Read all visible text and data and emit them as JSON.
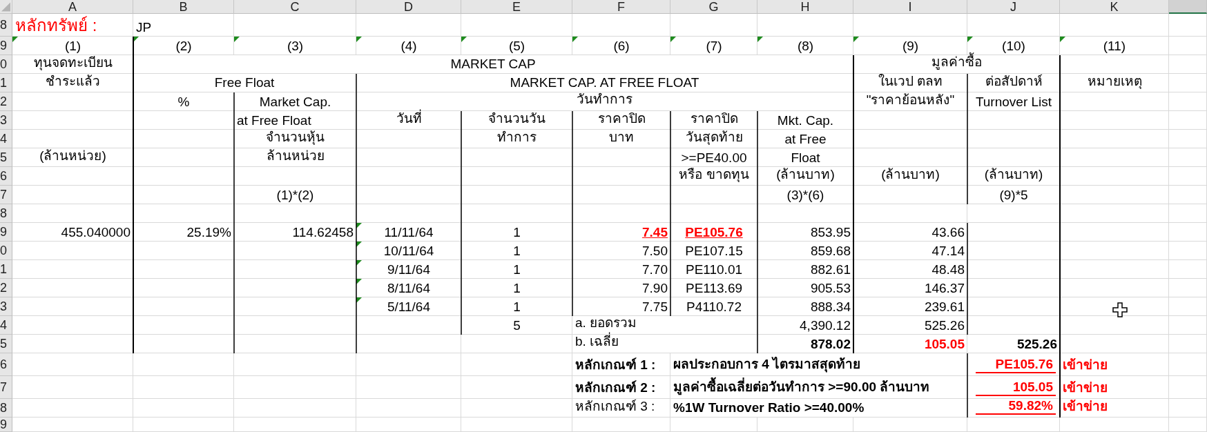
{
  "column_headers": [
    {
      "label": "A",
      "selected": false
    },
    {
      "label": "B",
      "selected": false
    },
    {
      "label": "C",
      "selected": false
    },
    {
      "label": "D",
      "selected": false
    },
    {
      "label": "E",
      "selected": false
    },
    {
      "label": "F",
      "selected": false
    },
    {
      "label": "G",
      "selected": false
    },
    {
      "label": "H",
      "selected": false
    },
    {
      "label": "I",
      "selected": false
    },
    {
      "label": "J",
      "selected": false
    },
    {
      "label": "K",
      "selected": false
    },
    {
      "selected": true
    }
  ],
  "row_numbers": [
    "8",
    "9",
    "0",
    "1",
    "2",
    "3",
    "4",
    "5",
    "6",
    "7",
    "8",
    "9",
    "0",
    "1",
    "2",
    "3",
    "4",
    "5",
    "6",
    "7",
    "8",
    "9"
  ],
  "security": {
    "label": "หลักทรัพย์ :",
    "value": "JP"
  },
  "column_numbers": [
    {
      "text": "(1)",
      "flagged": true
    },
    {
      "text": "(2)",
      "flagged": true
    },
    {
      "text": "(3)",
      "flagged": true
    },
    {
      "text": "(4)",
      "flagged": true
    },
    {
      "text": "(5)",
      "flagged": true
    },
    {
      "text": "(6)",
      "flagged": true
    },
    {
      "text": "(7)",
      "flagged": true
    },
    {
      "text": "(8)",
      "flagged": true
    },
    {
      "text": "(9)",
      "flagged": true
    },
    {
      "text": "(10)",
      "flagged": true
    },
    {
      "text": "(11)",
      "flagged": true
    }
  ],
  "header_rows": [
    [
      "ทุนจดทะเบียน",
      "MARKET CAP",
      "มูลค่าซื้อ"
    ],
    [
      "ชำระแล้ว",
      "Free Float",
      "MARKET CAP. AT FREE FLOAT",
      "ในเวป ตลท",
      "ต่อสัปดาห์",
      "หมายเหตุ"
    ],
    [
      "%",
      "Market Cap.",
      "วันทำการ",
      "\"ราคาย้อนหลัง\"",
      "Turnover List"
    ],
    [
      "at Free Float",
      "วันที่",
      "จำนวนวัน",
      "ราคาปิด",
      "ราคาปิด",
      "Mkt. Cap."
    ],
    [
      "จำนวนหุ้น",
      "ทำการ",
      "บาท",
      "วันสุดท้าย",
      "at Free"
    ],
    [
      "(ล้านหน่วย)",
      "ล้านหน่วย",
      ">=PE40.00",
      "Float"
    ],
    [
      "หรือ ขาดทุน",
      "(ล้านบาท)",
      "(ล้านบาท)",
      "(ล้านบาท)"
    ],
    [
      "(1)*(2)",
      "(3)*(6)",
      "(9)*5"
    ]
  ],
  "summary": {
    "registered_capital": "455.040000",
    "free_float_pct": "25.19%",
    "market_cap_free_float": "114.62458"
  },
  "days": [
    {
      "date": "11/11/64",
      "date_flagged": true,
      "count": "1",
      "close": "7.45",
      "close_alert": true,
      "pe": "PE105.76",
      "pe_alert": true,
      "mkt_cap": "853.95",
      "turnover": "43.66"
    },
    {
      "date": "10/11/64",
      "date_flagged": true,
      "count": "1",
      "close": "7.50",
      "close_alert": false,
      "pe": "PE107.15",
      "pe_alert": false,
      "mkt_cap": "859.68",
      "turnover": "47.14"
    },
    {
      "date": "9/11/64",
      "date_flagged": true,
      "count": "1",
      "close": "7.70",
      "close_alert": false,
      "pe": "PE110.01",
      "pe_alert": false,
      "mkt_cap": "882.61",
      "turnover": "48.48"
    },
    {
      "date": "8/11/64",
      "date_flagged": true,
      "count": "1",
      "close": "7.90",
      "close_alert": false,
      "pe": "PE113.69",
      "pe_alert": false,
      "mkt_cap": "905.53",
      "turnover": "146.37"
    },
    {
      "date": "5/11/64",
      "date_flagged": true,
      "count": "1",
      "close": "7.75",
      "close_alert": false,
      "pe": "P4110.72",
      "pe_alert": false,
      "mkt_cap": "888.34",
      "turnover": "239.61"
    }
  ],
  "totals": {
    "days": "5",
    "label": "a. ยอดรวม",
    "mkt_cap": "4,390.12",
    "turnover": "525.26"
  },
  "averages": {
    "label": "b. เฉลี่ย",
    "mkt_cap": "878.02",
    "turnover": "105.05",
    "weekly_turnover": "525.26"
  },
  "criteria": [
    {
      "label": "หลักเกณฑ์ 1 :",
      "label_bold": true,
      "description": "ผลประกอบการ 4 ไตรมาสสุดท้าย",
      "value": "PE105.76",
      "result": "เข้าข่าย",
      "met": true
    },
    {
      "label": "หลักเกณฑ์ 2 :",
      "label_bold": true,
      "description": "มูลค่าซื้อเฉลี่ยต่อวันทำการ >=90.00 ล้านบาท",
      "value": "105.05",
      "result": "เข้าข่าย",
      "met": true
    },
    {
      "label": "หลักเกณฑ์ 3 :",
      "label_bold": false,
      "description": "%1W Turnover Ratio >=40.00%",
      "value": "59.82%",
      "result": "เข้าข่าย",
      "met": true
    }
  ]
}
